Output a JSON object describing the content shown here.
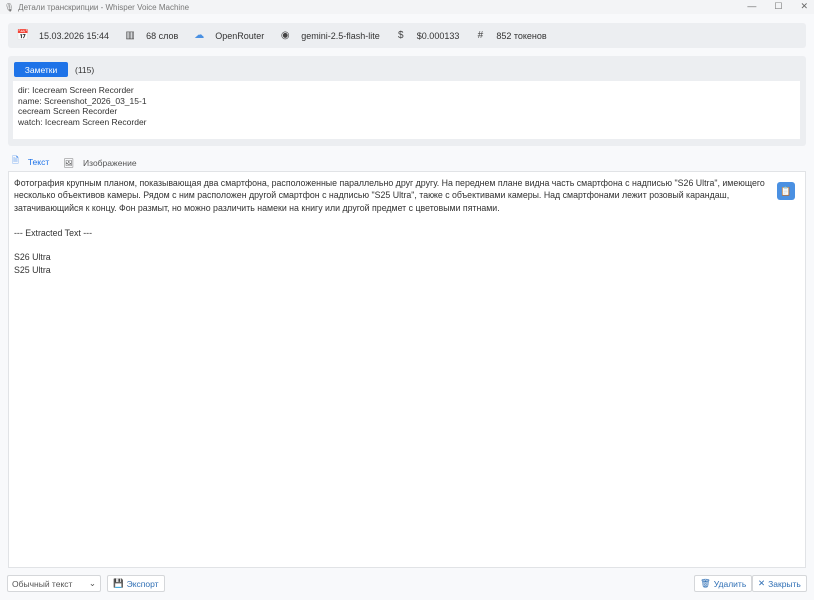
{
  "window": {
    "title": "Детали транскрипции - Whisper Voice Machine",
    "minimize": "—",
    "maximize": "☐",
    "close": "✕"
  },
  "info": [
    {
      "icon": "calendar-icon",
      "glyph": "📅",
      "text": "15.03.2026 15:44"
    },
    {
      "icon": "chart-icon",
      "glyph": "▥",
      "text": "68 слов"
    },
    {
      "icon": "cloud-icon",
      "glyph": "☁",
      "text": "OpenRouter"
    },
    {
      "icon": "eye-icon",
      "glyph": "◉",
      "text": "gemini-2.5-flash-lite"
    },
    {
      "icon": "dollar-icon",
      "glyph": "$",
      "text": "$0.000133"
    },
    {
      "icon": "hash-icon",
      "glyph": "#",
      "text": "852 токенов"
    }
  ],
  "notes": {
    "button": "Заметки",
    "count": "(115)",
    "text": "dir: Icecream Screen Recorder\nname: Screenshot_2026_03_15-1\ncecream Screen Recorder\nwatch: Icecream Screen Recorder"
  },
  "tabs": [
    {
      "label": "Текст"
    },
    {
      "label": "Изображение"
    }
  ],
  "content": "Фотография крупным планом, показывающая два смартфона, расположенные параллельно друг другу. На переднем плане видна часть смартфона с надписью \"S26 Ultra\", имеющего несколько объективов камеры. Рядом с ним расположен другой смартфон с надписью \"S25 Ultra\", также с объективами камеры. Над смартфонами лежит розовый карандаш, затачивающийся к концу. Фон размыт, но можно различить намеки на книгу или другой предмет с цветовыми пятнами.\n\n--- Extracted Text ---\n\nS26 Ultra\nS25 Ultra",
  "footer": {
    "format": "Обычный текст",
    "export": "Экспорт",
    "delete": "Удалить",
    "close": "Закрыть"
  },
  "colors": {
    "accent": "#1e73e8"
  }
}
